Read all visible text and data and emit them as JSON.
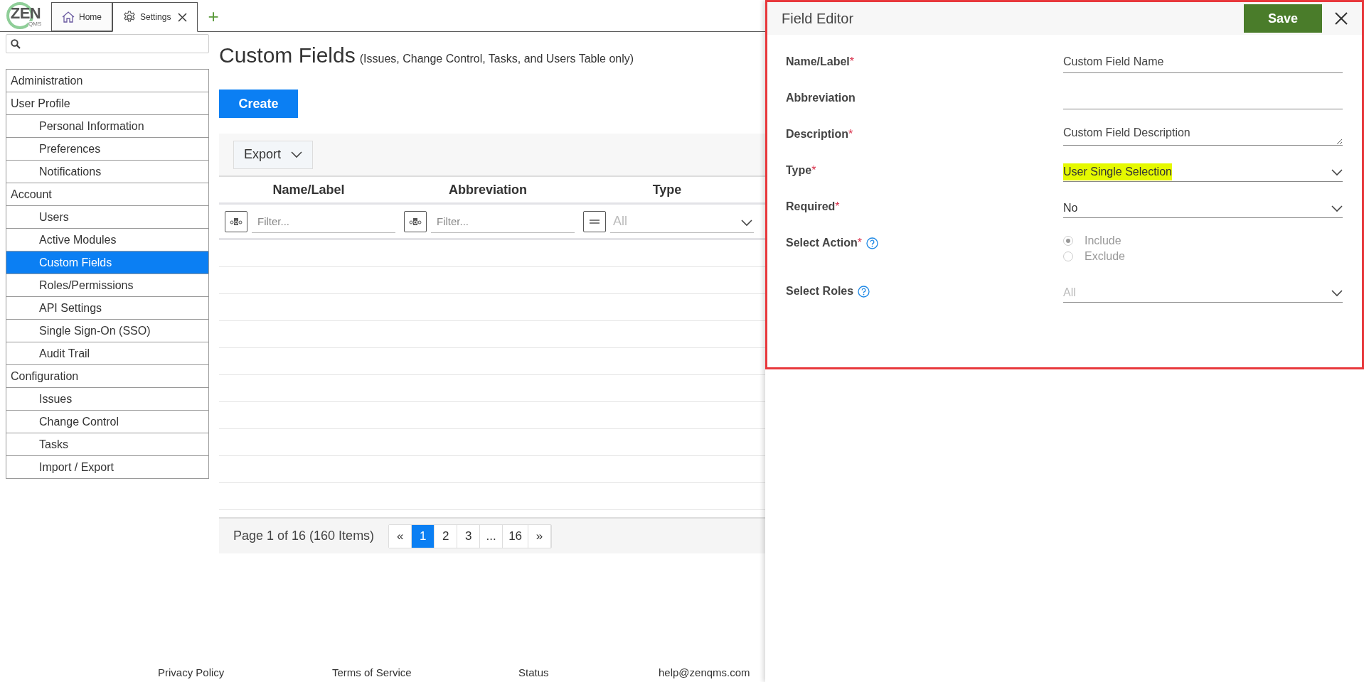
{
  "logo": {
    "text": "ZEN",
    "subtext": "QMS"
  },
  "tabs": [
    {
      "label": "Home",
      "selected": false,
      "closable": false
    },
    {
      "label": "Settings",
      "selected": true,
      "closable": true
    }
  ],
  "add_tab": "+",
  "sidebar": {
    "items": [
      {
        "label": "Administration",
        "selected": false
      },
      {
        "label": "User Profile",
        "selected": false,
        "children": [
          {
            "label": "Personal Information",
            "selected": false
          },
          {
            "label": "Preferences",
            "selected": false
          },
          {
            "label": "Notifications",
            "selected": false
          }
        ]
      },
      {
        "label": "Account",
        "selected": false,
        "children": [
          {
            "label": "Users",
            "selected": false
          },
          {
            "label": "Active Modules",
            "selected": false
          },
          {
            "label": "Custom Fields",
            "selected": true
          },
          {
            "label": "Roles/Permissions",
            "selected": false
          },
          {
            "label": "API Settings",
            "selected": false
          },
          {
            "label": "Single Sign-On (SSO)",
            "selected": false
          },
          {
            "label": "Audit Trail",
            "selected": false
          }
        ]
      },
      {
        "label": "Configuration",
        "selected": false,
        "children": [
          {
            "label": "Issues",
            "selected": false
          },
          {
            "label": "Change Control",
            "selected": false
          },
          {
            "label": "Tasks",
            "selected": false
          },
          {
            "label": "Import / Export",
            "selected": false
          }
        ]
      }
    ]
  },
  "page": {
    "title": "Custom Fields",
    "subtitle": "(Issues, Change Control, Tasks, and Users Table only)",
    "create_button": "Create"
  },
  "grid": {
    "export_button": "Export",
    "columns": [
      {
        "label": "Name/Label",
        "kind": "text",
        "placeholder": "Filter..."
      },
      {
        "label": "Abbreviation",
        "kind": "text",
        "placeholder": "Filter..."
      },
      {
        "label": "Type",
        "kind": "select",
        "placeholder": "All"
      }
    ],
    "pager": {
      "summary": "Page 1 of 16 (160 Items)",
      "pages": [
        {
          "label": "«",
          "selected": false
        },
        {
          "label": "1",
          "selected": true
        },
        {
          "label": "2",
          "selected": false
        },
        {
          "label": "3",
          "selected": false
        },
        {
          "label": "...",
          "selected": false
        },
        {
          "label": "16",
          "selected": false
        },
        {
          "label": "»",
          "selected": false
        }
      ]
    }
  },
  "footer": {
    "links": [
      "Privacy Policy",
      "Terms of Service",
      "Status",
      "help@zenqms.com"
    ]
  },
  "field_editor": {
    "title": "Field Editor",
    "save_button": "Save",
    "fields": [
      {
        "label": "Name/Label",
        "required_mark": "*",
        "kind": "text",
        "value": "Custom Field Name"
      },
      {
        "label": "Abbreviation",
        "kind": "text"
      },
      {
        "label": "Description",
        "required_mark": "*",
        "kind": "textarea",
        "value": "Custom Field Description"
      },
      {
        "label": "Type",
        "required_mark": "*",
        "kind": "select",
        "value": "User Single Selection",
        "highlighted": true
      },
      {
        "label": "Required",
        "required_mark": "*",
        "kind": "select",
        "value": "No"
      },
      {
        "label": "Select Action",
        "required_mark": "*",
        "help": true,
        "kind": "radio",
        "disabled": true,
        "options": [
          {
            "label": "Include",
            "selected": true
          },
          {
            "label": "Exclude",
            "selected": false
          }
        ]
      },
      {
        "label": "Select Roles",
        "help": true,
        "kind": "select",
        "placeholder": "All"
      }
    ]
  }
}
